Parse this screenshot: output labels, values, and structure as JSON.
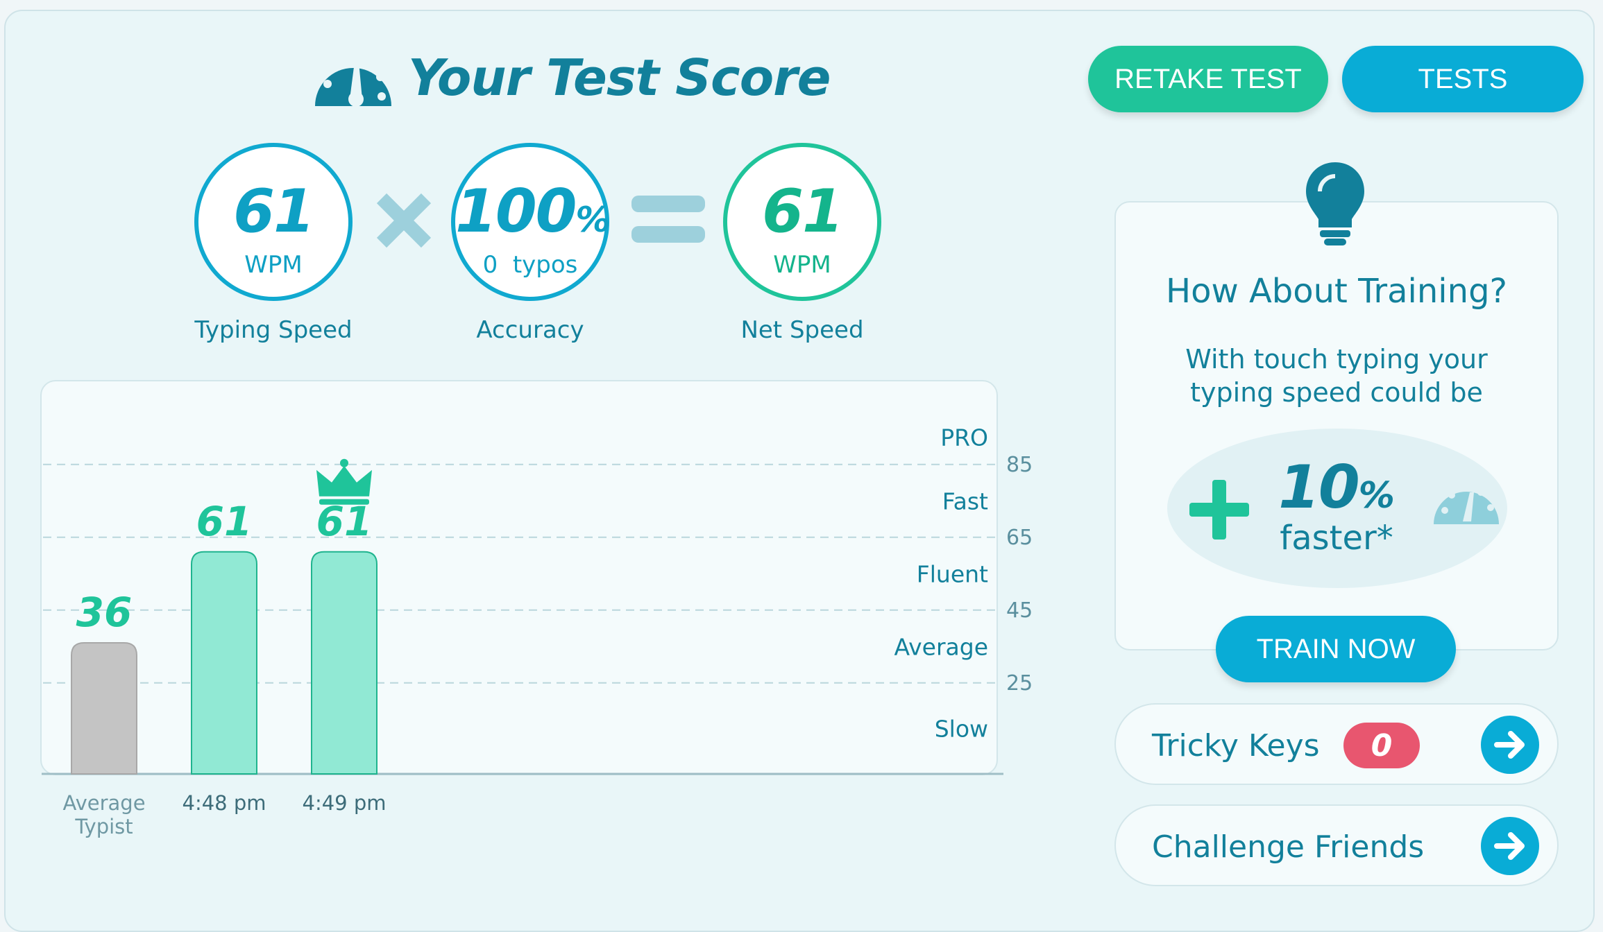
{
  "header": {
    "title": "Your Test Score"
  },
  "actions": {
    "retake_label": "RETAKE TEST",
    "tests_label": "TESTS"
  },
  "scores": {
    "speed": {
      "value": "61",
      "unit": "WPM",
      "label": "Typing Speed"
    },
    "accuracy": {
      "value": "100",
      "suffix": "%",
      "typos_count": "0",
      "typos_word": "typos",
      "label": "Accuracy"
    },
    "net": {
      "value": "61",
      "unit": "WPM",
      "label": "Net Speed"
    }
  },
  "chart_data": {
    "type": "bar",
    "categories": [
      "Average Typist",
      "4:48 pm",
      "4:49 pm"
    ],
    "values": [
      36,
      61,
      61
    ],
    "data_labels": [
      "36",
      "61",
      "61"
    ],
    "highlight_index": 2,
    "ylim": [
      0,
      100
    ],
    "y_ticks": [
      25,
      45,
      65,
      85
    ],
    "bands": [
      "Slow",
      "Average",
      "Fluent",
      "Fast",
      "PRO"
    ],
    "grid": true,
    "colors": {
      "baseline": "#c4c4c4",
      "result": "#91e9d4",
      "result_edge": "#1fb48e",
      "label": "#1fc49a",
      "crown": "#1fc49a"
    }
  },
  "training": {
    "title": "How About Training?",
    "text": "With touch typing your typing speed could be",
    "boost_value": "10",
    "boost_suffix": "%",
    "boost_text": "faster*",
    "button_label": "TRAIN NOW"
  },
  "tricky_keys": {
    "label": "Tricky Keys",
    "count": "0"
  },
  "challenge": {
    "label": "Challenge Friends"
  },
  "colors": {
    "brand": "#12809b",
    "green": "#1fc49a",
    "blue": "#09acd6",
    "badge": "#e8566f"
  }
}
